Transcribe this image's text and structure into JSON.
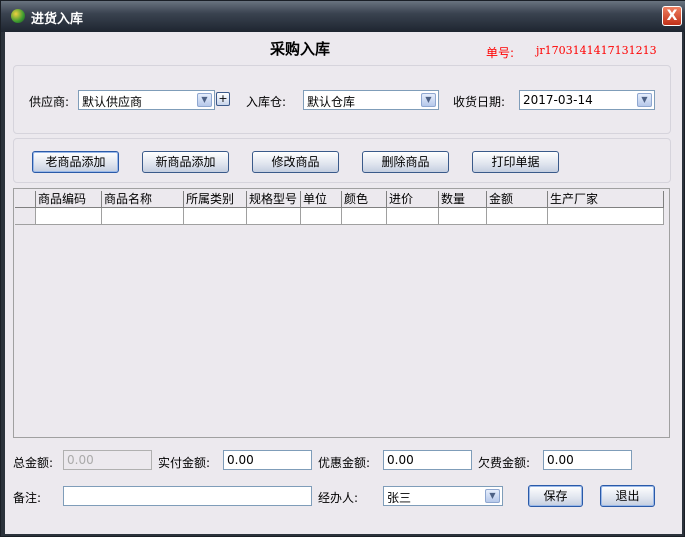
{
  "window": {
    "title": "进货入库",
    "close": "X"
  },
  "header": {
    "title": "采购入库",
    "order_label": "单号:",
    "order_no": "jr1703141417131213"
  },
  "filters": {
    "supplier_label": "供应商:",
    "supplier_value": "默认供应商",
    "add_supplier": "+",
    "warehouse_label": "入库仓:",
    "warehouse_value": "默认仓库",
    "date_label": "收货日期:",
    "date_value": "2017-03-14"
  },
  "toolbar": {
    "buttons": [
      "老商品添加",
      "新商品添加",
      "修改商品",
      "删除商品",
      "打印单据"
    ]
  },
  "table": {
    "columns": [
      "商品编码",
      "商品名称",
      "所属类别",
      "规格型号",
      "单位",
      "颜色",
      "进价",
      "数量",
      "金额",
      "生产厂家"
    ]
  },
  "footer": {
    "total_label": "总金额:",
    "total_value": "0.00",
    "paid_label": "实付金额:",
    "paid_value": "0.00",
    "discount_label": "优惠金额:",
    "discount_value": "0.00",
    "owed_label": "欠费金额:",
    "owed_value": "0.00",
    "note_label": "备注:",
    "note_value": "",
    "handler_label": "经办人:",
    "handler_value": "张三",
    "save": "保存",
    "exit": "退出"
  }
}
